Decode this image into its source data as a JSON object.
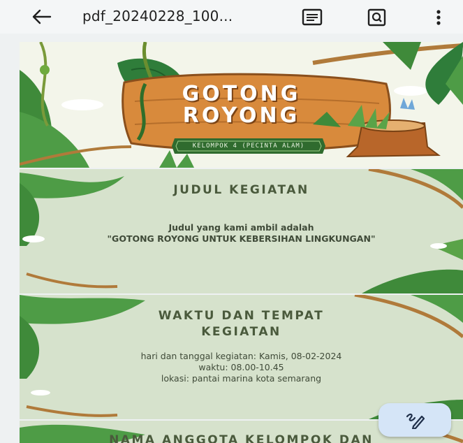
{
  "toolbar": {
    "title": "pdf_20240228_100...",
    "back_icon": "arrow-back-icon",
    "reflow_icon": "text-view-icon",
    "search_icon": "search-in-document-icon",
    "more_icon": "more-vertical-icon"
  },
  "pages": {
    "cover": {
      "title_line1": "GOTONG",
      "title_line2": "ROYONG",
      "group": "KELOMPOK 4 (PECINTA ALAM)"
    },
    "activity_title": {
      "heading": "JUDUL KEGIATAN",
      "line1": "Judul yang kami ambil adalah",
      "line2": "\"GOTONG ROYONG UNTUK KEBERSIHAN LINGKUNGAN\""
    },
    "time_place": {
      "heading_line1": "WAKTU DAN TEMPAT",
      "heading_line2": "KEGIATAN",
      "line1": "hari dan tanggal kegiatan: Kamis, 08-02-2024",
      "line2": "waktu: 08.00-10.45",
      "line3": "lokasi: pantai marina kota semarang"
    },
    "members": {
      "heading": "NAMA ANGGOTA KELOMPOK DAN"
    }
  },
  "fab": {
    "icon": "annotate-pen-icon"
  },
  "colors": {
    "page_bg": "#d6e2cc",
    "heading_text": "#4a5a3c",
    "sign_wood": "#d88a3c",
    "leaf_green": "#3f8a3a",
    "fab_bg": "#d5e5f7"
  }
}
